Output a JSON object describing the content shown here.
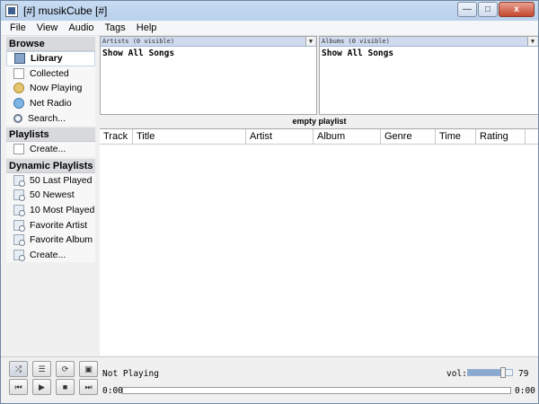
{
  "window": {
    "title": "[#] musikCube [#]",
    "close_label": "x"
  },
  "menu": [
    "File",
    "View",
    "Audio",
    "Tags",
    "Help"
  ],
  "sidebar": {
    "browse_header": "Browse",
    "browse_items": [
      {
        "label": "Library",
        "icon": "library-icon"
      },
      {
        "label": "Collected",
        "icon": "document-icon"
      },
      {
        "label": "Now Playing",
        "icon": "note-icon"
      },
      {
        "label": "Net Radio",
        "icon": "globe-icon"
      },
      {
        "label": "Search...",
        "icon": "search-icon"
      }
    ],
    "playlists_header": "Playlists",
    "playlists_items": [
      {
        "label": "Create...",
        "icon": "document-icon"
      }
    ],
    "dynamic_header": "Dynamic Playlists",
    "dynamic_items": [
      {
        "label": "50 Last Played",
        "icon": "dynamic-playlist-icon"
      },
      {
        "label": "50 Newest",
        "icon": "dynamic-playlist-icon"
      },
      {
        "label": "10 Most Played",
        "icon": "dynamic-playlist-icon"
      },
      {
        "label": "Favorite Artist",
        "icon": "dynamic-playlist-icon"
      },
      {
        "label": "Favorite Album",
        "icon": "dynamic-playlist-icon"
      },
      {
        "label": "Create...",
        "icon": "dynamic-playlist-icon"
      }
    ]
  },
  "artists_panel": {
    "header": "Artists (0 visible)",
    "item": "Show All Songs"
  },
  "albums_panel": {
    "header": "Albums (0 visible)",
    "item": "Show All Songs"
  },
  "playlist": {
    "title": "empty playlist",
    "columns": [
      "Track",
      "Title",
      "Artist",
      "Album",
      "Genre",
      "Time",
      "Rating"
    ]
  },
  "player": {
    "status": "Not Playing",
    "volume_label": "vol:",
    "volume_value": "79",
    "volume_level": 0.79,
    "time_elapsed": "0:00",
    "time_total": "0:00",
    "progress": 0
  },
  "colors": {
    "accent": "#8aa9d1",
    "panel_header": "#cfdaee"
  }
}
